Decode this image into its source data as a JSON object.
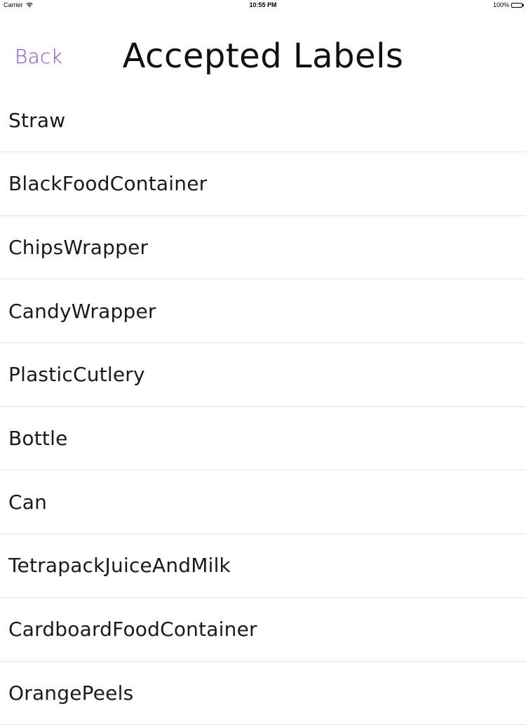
{
  "status_bar": {
    "carrier": "Carrier",
    "time": "10:55 PM",
    "battery": "100%",
    "wifi_icon": "wifi-icon",
    "battery_icon": "battery-icon"
  },
  "nav": {
    "back_label": "Back",
    "title": "Accepted Labels",
    "accent_color": "#7f4fd0"
  },
  "labels": [
    "Straw",
    "BlackFoodContainer",
    "ChipsWrapper",
    "CandyWrapper",
    "PlasticCutlery",
    "Bottle",
    "Can",
    "TetrapackJuiceAndMilk",
    "CardboardFoodContainer",
    "OrangePeels"
  ]
}
